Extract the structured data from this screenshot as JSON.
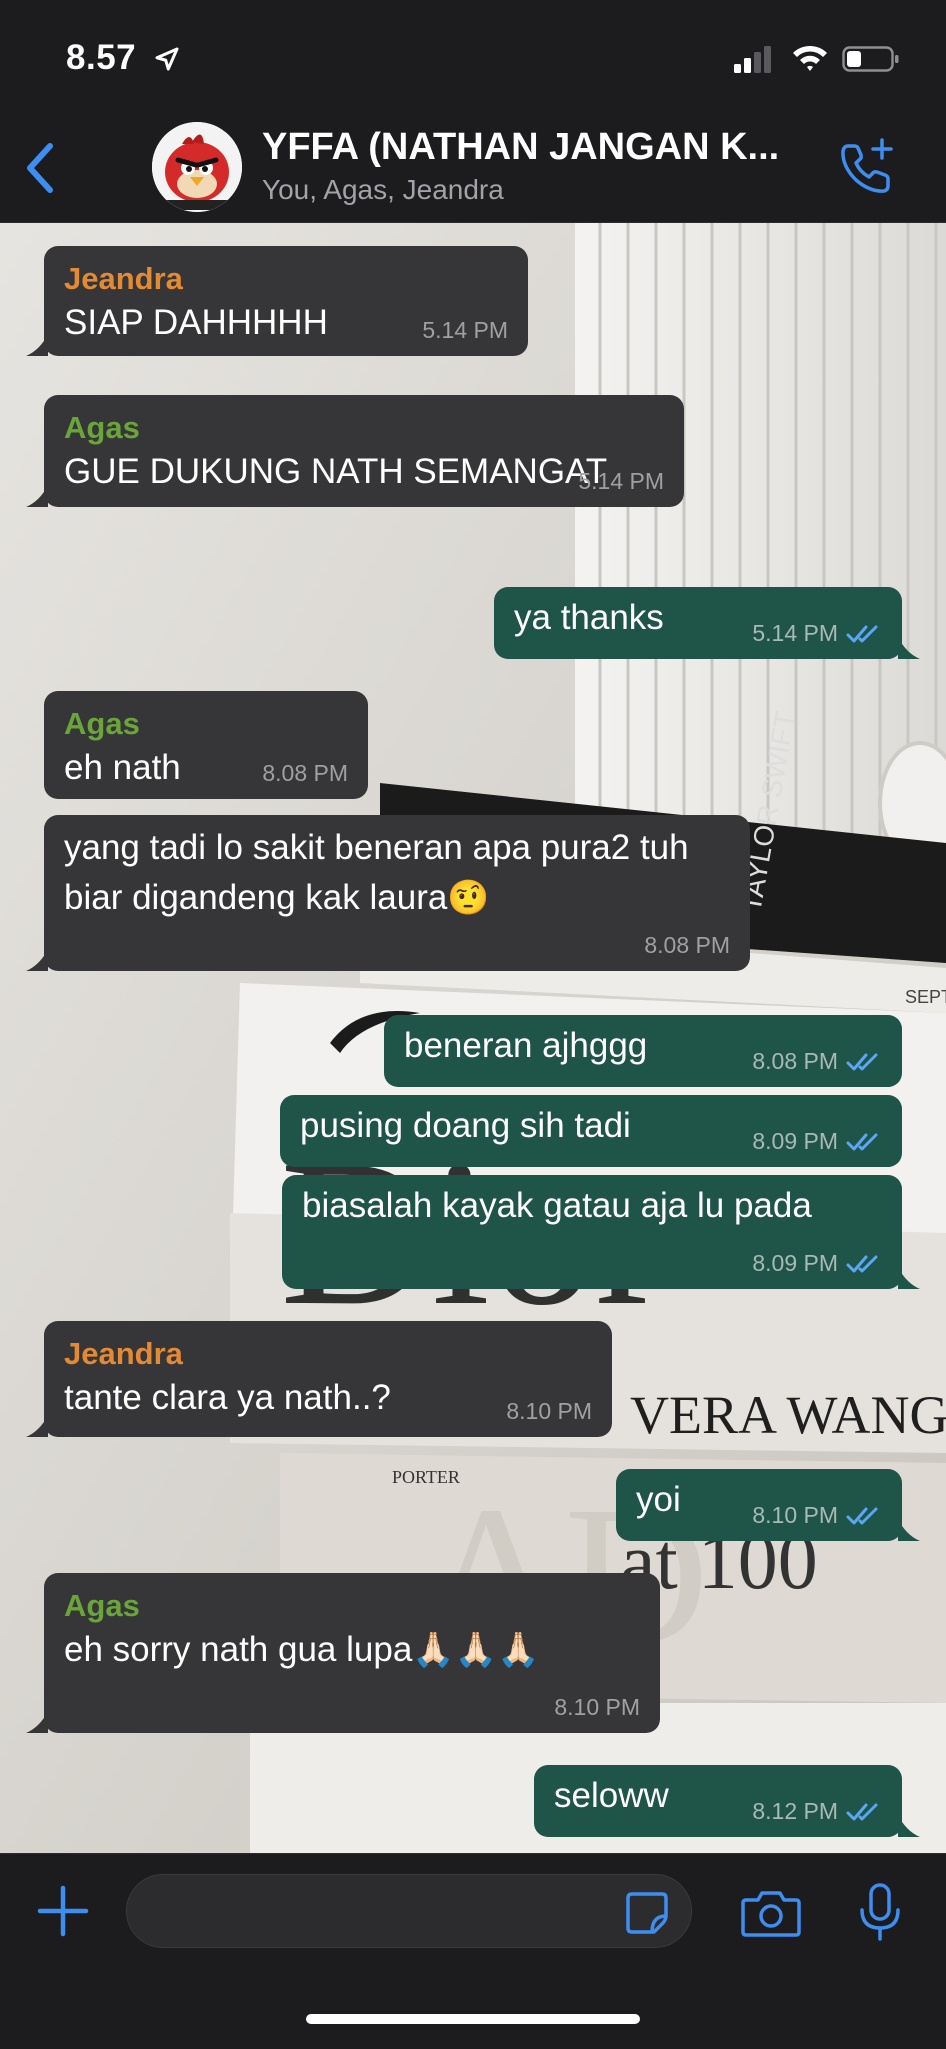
{
  "status_bar": {
    "time": "8.57"
  },
  "header": {
    "title": "YFFA (NATHAN JANGAN K...",
    "subtitle": "You, Agas, Jeandra"
  },
  "messages": [
    {
      "from": "Jeandra",
      "text": "SIAP DAHHHHH",
      "time": "5.14 PM",
      "outgoing": false
    },
    {
      "from": "Agas",
      "text": "GUE DUKUNG NATH SEMANGAT",
      "time": "5.14 PM",
      "outgoing": false
    },
    {
      "text": "ya thanks",
      "time": "5.14 PM",
      "outgoing": true
    },
    {
      "from": "Agas",
      "text": "eh nath",
      "time": "8.08 PM",
      "outgoing": false
    },
    {
      "text": "yang tadi lo sakit beneran apa pura2 tuh biar digandeng kak laura",
      "emoji": "🤨",
      "time": "8.08 PM",
      "outgoing": false
    },
    {
      "text": "beneran ajhggg",
      "time": "8.08 PM",
      "outgoing": true
    },
    {
      "text": "pusing doang sih tadi",
      "time": "8.09 PM",
      "outgoing": true
    },
    {
      "text": "biasalah kayak gatau aja lu pada",
      "time": "8.09 PM",
      "outgoing": true
    },
    {
      "from": "Jeandra",
      "text": "tante clara ya nath..?",
      "time": "8.10 PM",
      "outgoing": false
    },
    {
      "text": "yoi",
      "time": "8.10 PM",
      "outgoing": true
    },
    {
      "from": "Agas",
      "text": "eh sorry nath gua lupa",
      "emoji": "🙏🏻🙏🏻🙏🏻",
      "time": "8.10 PM",
      "outgoing": false
    },
    {
      "text": "seloww",
      "time": "8.12 PM",
      "outgoing": true
    }
  ],
  "wallpaper": {
    "book_titles": [
      "TAYLOR SWIFT",
      "SEPT",
      "Dior",
      "VERA WANG",
      "PORTER",
      "AD at 100"
    ]
  },
  "colors": {
    "incoming_bubble": "#363638",
    "outgoing_bubble": "#1f5448",
    "jeandra_name": "#e38a35",
    "agas_name": "#6aa53a",
    "accent": "#3d8ef0"
  }
}
